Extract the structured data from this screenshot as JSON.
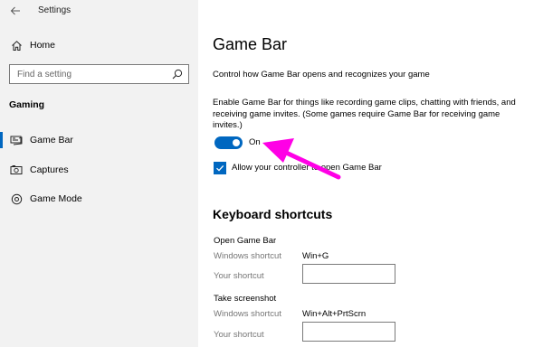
{
  "window": {
    "title": "Settings"
  },
  "sidebar": {
    "home_label": "Home",
    "search": {
      "placeholder": "Find a setting"
    },
    "section": "Gaming",
    "items": [
      {
        "label": "Game Bar",
        "icon": "game-bar-icon",
        "active": true
      },
      {
        "label": "Captures",
        "icon": "captures-icon",
        "active": false
      },
      {
        "label": "Game Mode",
        "icon": "game-mode-icon",
        "active": false
      }
    ]
  },
  "main": {
    "title": "Game Bar",
    "description": "Control how Game Bar opens and recognizes your game",
    "enable_description": "Enable Game Bar for things like recording game clips, chatting with friends, and receiving game invites. (Some games require Game Bar for receiving game invites.)",
    "toggle": {
      "state_label": "On",
      "on": true
    },
    "checkbox": {
      "label": "Allow your controller to open Game Bar",
      "checked": true
    },
    "shortcuts_heading": "Keyboard shortcuts",
    "shortcut_groups": [
      {
        "title": "Open Game Bar",
        "windows_shortcut_label": "Windows shortcut",
        "windows_shortcut_value": "Win+G",
        "your_shortcut_label": "Your shortcut",
        "your_shortcut_value": ""
      },
      {
        "title": "Take screenshot",
        "windows_shortcut_label": "Windows shortcut",
        "windows_shortcut_value": "Win+Alt+PrtScrn",
        "your_shortcut_label": "Your shortcut",
        "your_shortcut_value": ""
      }
    ]
  },
  "colors": {
    "accent": "#0067c0",
    "sidebar_bg": "#f2f2f2",
    "annotation_arrow": "#ff00e6"
  }
}
